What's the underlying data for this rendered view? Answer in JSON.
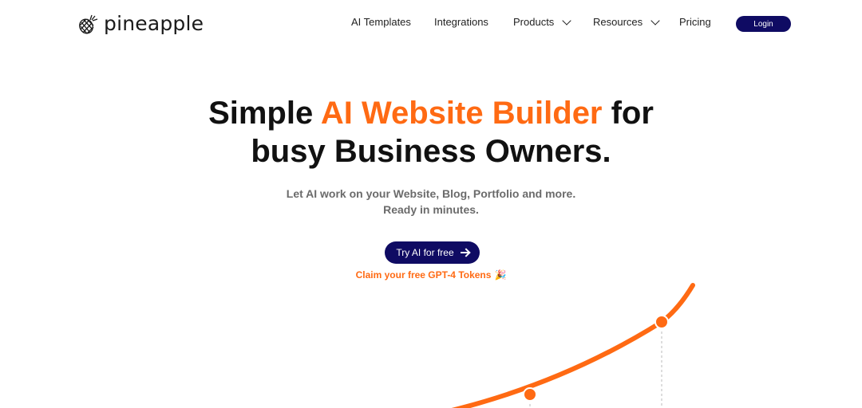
{
  "app": {
    "logo_text": "pineapple",
    "logo_icon": "pineapple-icon"
  },
  "nav": {
    "items": [
      {
        "label": "AI Templates",
        "has_dropdown": false
      },
      {
        "label": "Integrations",
        "has_dropdown": false
      },
      {
        "label": "Products",
        "has_dropdown": true
      },
      {
        "label": "Resources",
        "has_dropdown": true
      },
      {
        "label": "Pricing",
        "has_dropdown": false
      }
    ],
    "login_label": "Login"
  },
  "hero": {
    "title_part1": "Simple ",
    "title_accent": "AI Website Builder",
    "title_part2": " for",
    "title_line2": "busy Business Owners.",
    "subtitle_line1": "Let AI work on your Website, Blog, Portfolio and more.",
    "subtitle_line2": "Ready in minutes.",
    "cta_label": "Try AI for free",
    "claim_text": "Claim your free GPT-4 Tokens",
    "claim_emoji": "🎉"
  },
  "colors": {
    "accent": "#ff6a13",
    "brand_navy": "#0f0b63",
    "text": "#111111",
    "muted": "#6b6b6b"
  }
}
